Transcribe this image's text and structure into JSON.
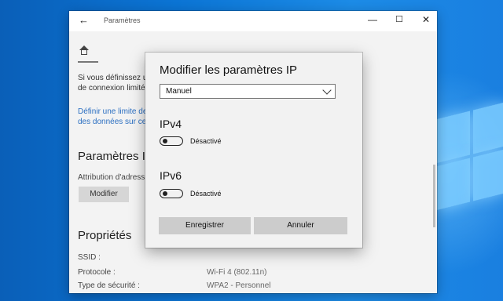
{
  "window": {
    "title": "Paramètres",
    "back_glyph": "←",
    "minimize_glyph": "—",
    "maximize_glyph": "☐",
    "close_glyph": "✕"
  },
  "background_page": {
    "text_line1": "Si vous définissez u",
    "text_line2": "de connexion limité",
    "link_line1": "Définir une limite de",
    "link_line2": "des données sur ce",
    "section_ip_title": "Paramètres IP",
    "ip_assignment_label": "Attribution d'adress",
    "modify_button": "Modifier",
    "properties_title": "Propriétés",
    "props": [
      {
        "label": "SSID :",
        "value": ""
      },
      {
        "label": "Protocole :",
        "value": "Wi-Fi 4 (802.11n)"
      },
      {
        "label": "Type de sécurité :",
        "value": "WPA2 - Personnel"
      }
    ]
  },
  "dialog": {
    "title": "Modifier les paramètres IP",
    "select_value": "Manuel",
    "ipv4": {
      "title": "IPv4",
      "toggle_state": "Désactivé"
    },
    "ipv6": {
      "title": "IPv6",
      "toggle_state": "Désactivé"
    },
    "save_button": "Enregistrer",
    "cancel_button": "Annuler"
  },
  "colors": {
    "link": "#2a6ec1",
    "desktop": "#0b74d4",
    "button": "#cccccc"
  }
}
